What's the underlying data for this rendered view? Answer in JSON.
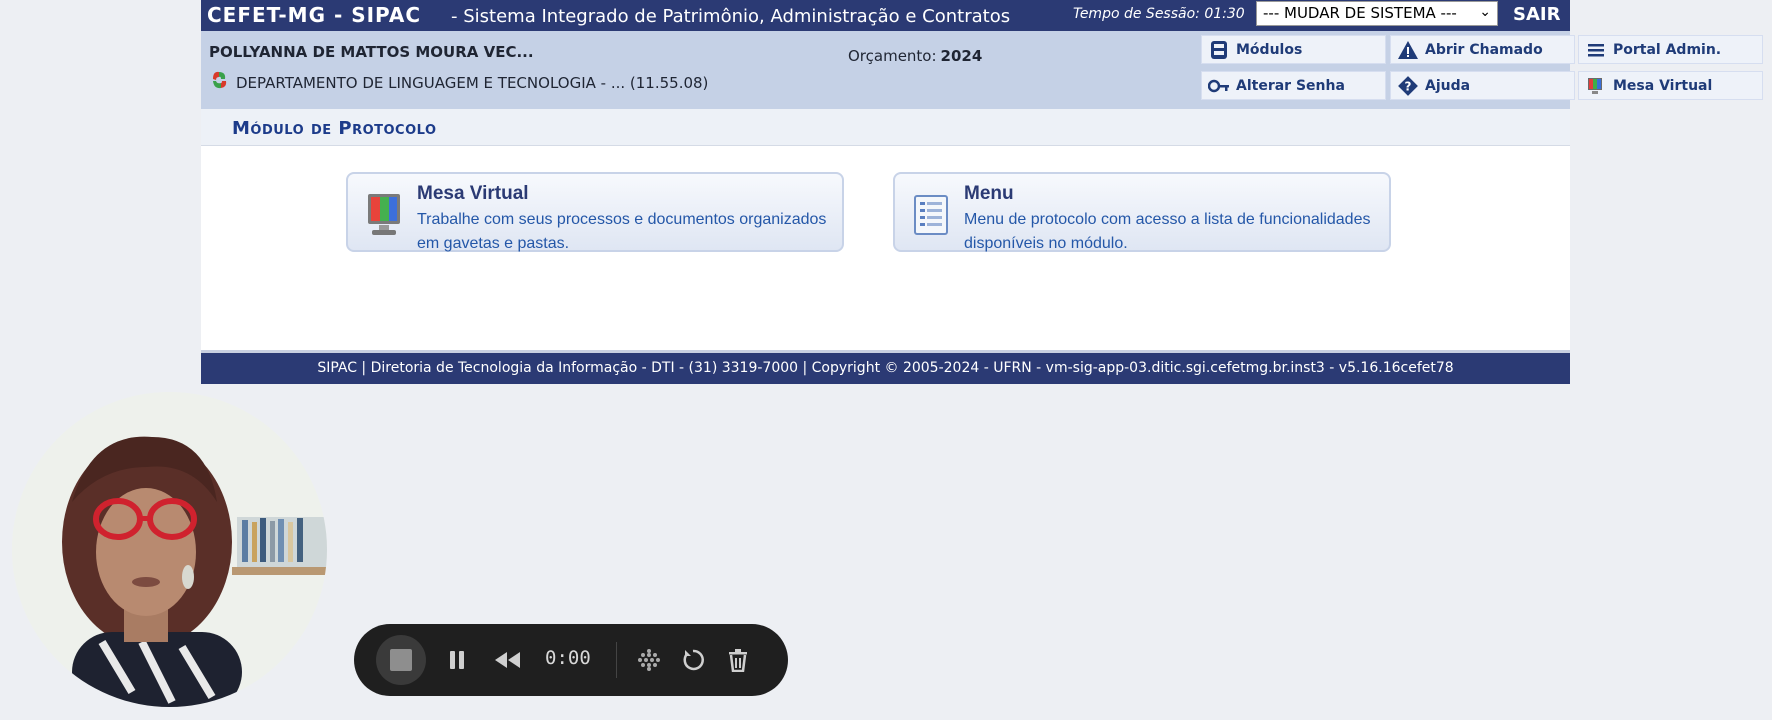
{
  "header": {
    "brand": "CEFET-MG - SIPAC",
    "subtitle": "- Sistema Integrado de Patrimônio, Administração e Contratos",
    "session_label": "Tempo de Sessão: 01:30",
    "system_select": "--- MUDAR DE SISTEMA ---",
    "logout": "SAIR"
  },
  "user": {
    "name": "POLLYANNA DE MATTOS MOURA VEC...",
    "department": "DEPARTAMENTO DE LINGUAGEM E TECNOLOGIA - ... (11.55.08)",
    "budget_label": "Orçamento:",
    "budget_year": "2024"
  },
  "quick_links": [
    {
      "label": "Módulos",
      "icon": "modules-icon"
    },
    {
      "label": "Abrir Chamado",
      "icon": "warning-icon"
    },
    {
      "label": "Portal Admin.",
      "icon": "menu-list-icon"
    },
    {
      "label": "Alterar Senha",
      "icon": "key-icon"
    },
    {
      "label": "Ajuda",
      "icon": "help-icon"
    },
    {
      "label": "Mesa Virtual",
      "icon": "monitor-icon"
    }
  ],
  "module": {
    "title": "Módulo de Protocolo"
  },
  "cards": [
    {
      "title": "Mesa Virtual",
      "description": "Trabalhe com seus processos e documentos organizados em gavetas e pastas.",
      "icon": "monitor-icon"
    },
    {
      "title": "Menu",
      "description": "Menu de protocolo com acesso a lista de funcionalidades disponíveis no módulo.",
      "icon": "document-list-icon"
    }
  ],
  "footer": {
    "text": "SIPAC | Diretoria de Tecnologia da Informação - DTI - (31) 3319-7000 | Copyright © 2005-2024 - UFRN - vm-sig-app-03.ditic.sgi.cefetmg.br.inst3 - v5.16.16cefet78"
  },
  "recorder": {
    "time": "0:00",
    "icons": [
      "stop-icon",
      "pause-icon",
      "rewind-icon",
      "grid-dots-icon",
      "restart-icon",
      "trash-icon"
    ]
  },
  "colors": {
    "navy": "#2b3a74",
    "info_bg": "#c5d1e6",
    "link_blue": "#2457a8"
  }
}
